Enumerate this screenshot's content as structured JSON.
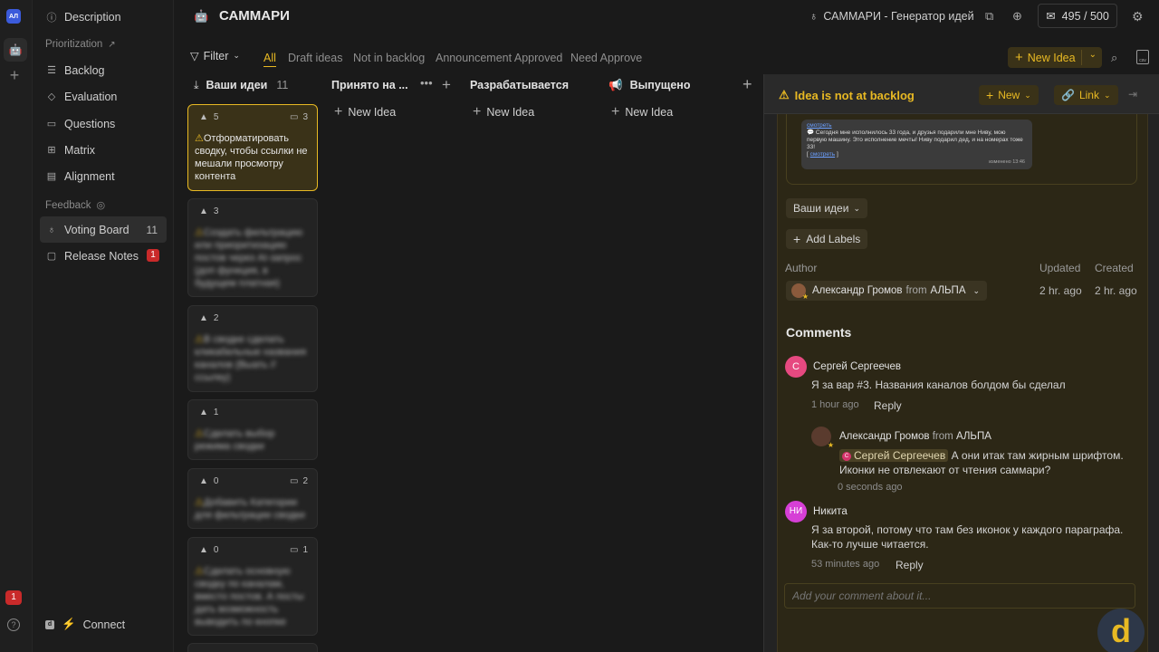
{
  "rail": {
    "workspace_initials": "АЛ",
    "notifications": "1"
  },
  "sidebar": {
    "items_top": [
      {
        "label": "Description",
        "icon": "info-icon"
      }
    ],
    "prioritization_label": "Prioritization",
    "prioritization": [
      {
        "label": "Backlog",
        "icon": "list-icon"
      },
      {
        "label": "Evaluation",
        "icon": "evaluation-icon"
      },
      {
        "label": "Questions",
        "icon": "questions-icon"
      },
      {
        "label": "Matrix",
        "icon": "grid-icon"
      },
      {
        "label": "Alignment",
        "icon": "alignment-icon"
      }
    ],
    "feedback_label": "Feedback",
    "feedback": [
      {
        "label": "Voting Board",
        "count": "11",
        "icon": "bulb-icon"
      },
      {
        "label": "Release Notes",
        "count": "1",
        "icon": "note-icon"
      }
    ],
    "connect_label": "Connect"
  },
  "header": {
    "title": "САММАРИ",
    "portal": "САММАРИ - Генератор идей",
    "mail_count": "495 / 500"
  },
  "filterbar": {
    "filter_label": "Filter",
    "tabs": [
      "All",
      "Draft ideas",
      "Not in backlog",
      "Announcement Approved",
      "Need Approve"
    ],
    "new_idea_label": "New Idea"
  },
  "columns": [
    {
      "title": "Ваши идеи",
      "count": "11"
    },
    {
      "title": "Принято на ..."
    },
    {
      "title": "Разрабатывается"
    },
    {
      "title": "Выпущено"
    }
  ],
  "new_idea_row": "New Idea",
  "cards": [
    {
      "votes": "5",
      "comments": "3",
      "text": "Отформатировать сводку, чтобы ссылки не мешали просмотру контента"
    },
    {
      "votes": "3",
      "comments": "",
      "text": "Создать фильтрацию или приоритизацию постов через AI-запрос (доп функция, в будущем платная)"
    },
    {
      "votes": "2",
      "comments": "",
      "text": "В сводке сделать кликабельные названия каналов (Выать // ссылку)"
    },
    {
      "votes": "1",
      "comments": "",
      "text": "Сделать выбор режима сводки"
    },
    {
      "votes": "0",
      "comments": "2",
      "text": "Добавить Категории для фильтрации сводки"
    },
    {
      "votes": "0",
      "comments": "1",
      "text": "Сделать основную сводку по каналам, вместо постов. А посты дать возможность выводить по кнопке"
    }
  ],
  "panel": {
    "title": "Idea is not at backlog",
    "new_label": "New",
    "link_label": "Link",
    "screenshot": {
      "top_link": "смотреть",
      "message": "Сегодня мне исполнилось 33 года, и друзья подарили мне Ниву, мою первую машину. Это исполнение мечты! Ниву подарил дед, и на номерах тоже 33!",
      "link": "смотреть",
      "time": "изменено 13:46"
    },
    "status_chip": "Ваши идеи",
    "add_labels": "Add Labels",
    "author_label": "Author",
    "updated_label": "Updated",
    "created_label": "Created",
    "author_name": "Александр Громов",
    "author_from": "from",
    "author_org": "АЛЬПА",
    "updated": "2 hr. ago",
    "created": "2 hr. ago",
    "comments_title": "Comments",
    "comments": [
      {
        "initials": "С",
        "name": "Сергей Сергеечев",
        "text": "Я за вар #3. Названия каналов болдом бы сделал",
        "time": "1 hour ago",
        "reply": "Reply"
      },
      {
        "name": "Александр Громов",
        "from": "from",
        "org": "АЛЬПА",
        "mention": "Сергей Сергеечев",
        "mention_initial": "С",
        "text": "А они итак там жирным шрифтом.",
        "text2": "Иконки не отвлекают от чтения саммари?",
        "time": "0 seconds ago"
      },
      {
        "initials": "НИ",
        "name": "Никита",
        "text": "Я за второй, потому что там без иконок у каждого параграфа.",
        "text2": "Как-то лучше читается.",
        "time": "53 minutes ago",
        "reply": "Reply"
      }
    ],
    "comment_placeholder": "Add your comment about it..."
  },
  "brand_letter": "d",
  "colors": {
    "accent": "#e8b923",
    "danger": "#c92a2a",
    "panel_bg": "#2c2716"
  }
}
